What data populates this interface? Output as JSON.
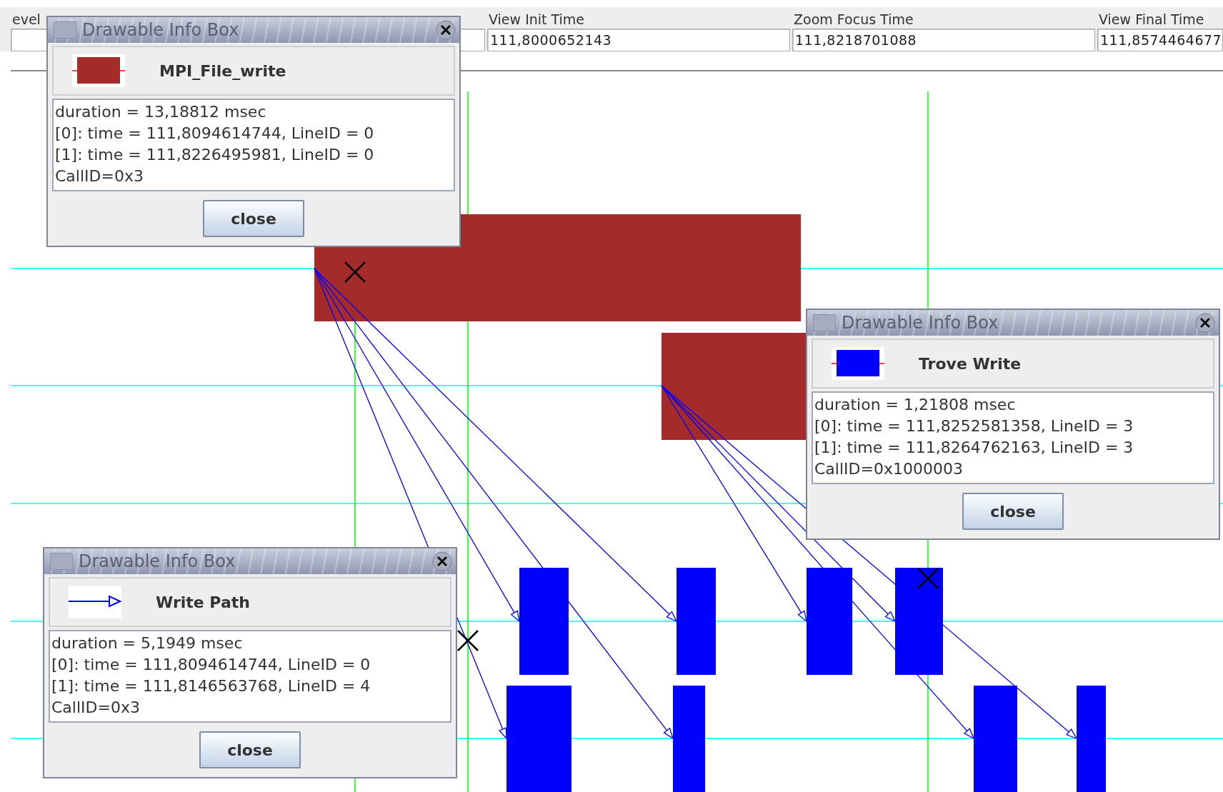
{
  "header": {
    "level_label": "evel",
    "fields": [
      {
        "label": "View Init Time",
        "value": "111,8000652143"
      },
      {
        "label": "Zoom Focus Time",
        "value": "111,8218701088"
      },
      {
        "label": "View Final Time",
        "value": "111,8574464677"
      }
    ]
  },
  "dialogs": [
    {
      "title": "Drawable Info Box",
      "kind": "state",
      "color": "#a52a2a",
      "name": "MPI_File_write",
      "lines": [
        "duration = 13,18812 msec",
        "[0]: time = 111,8094614744, LineID = 0",
        "[1]: time = 111,8226495981, LineID = 0",
        "CallID=0x3"
      ],
      "button": "close"
    },
    {
      "title": "Drawable Info Box",
      "kind": "state",
      "color": "#0000ff",
      "name": "Trove Write",
      "lines": [
        "duration = 1,21808 msec",
        "[0]: time = 111,8252581358, LineID = 3",
        "[1]: time = 111,8264762163, LineID = 3",
        "CallID=0x1000003"
      ],
      "button": "close"
    },
    {
      "title": "Drawable Info Box",
      "kind": "arrow",
      "color": "#0000ff",
      "name": "Write Path",
      "lines": [
        "duration = 5,1949 msec",
        "[0]: time = 111,8094614744, LineID = 0",
        "[1]: time = 111,8146563768, LineID = 4",
        "CallID=0x3"
      ],
      "button": "close"
    }
  ]
}
